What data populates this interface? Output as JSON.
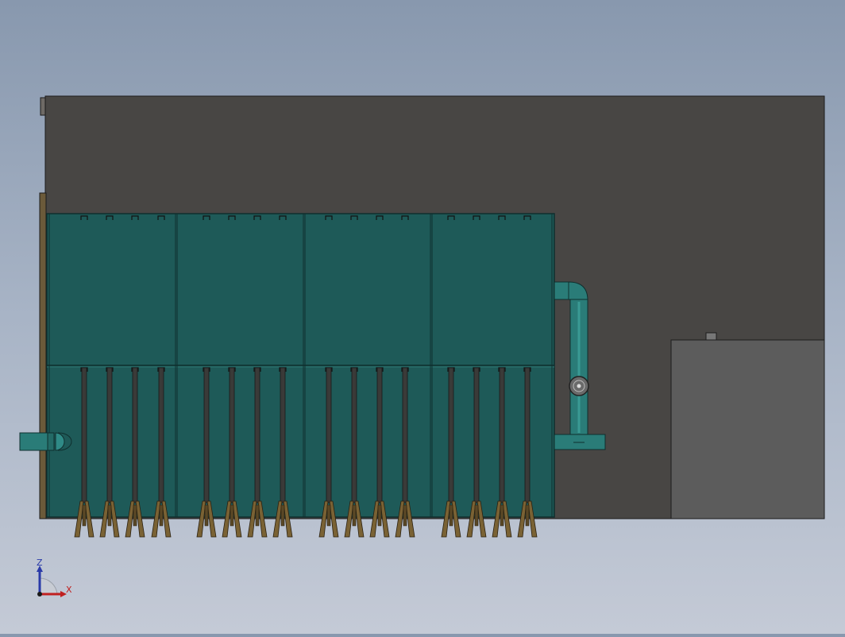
{
  "view": {
    "description_colors": {
      "background_top": "#8898ae",
      "background_bottom": "#c4cad6",
      "frame_body": "#484644",
      "tank_fill": "#1e5a58",
      "tank_edge": "#0f2f2e",
      "pipe": "#2a7c78",
      "rod": "#3a3a38",
      "mixer_blade": "#7a6234",
      "side_box": "#5c5c5c"
    },
    "module_count": 4,
    "rods_per_module": 4
  },
  "triad": {
    "z_label": "Z",
    "x_label": "X",
    "z_color": "#2a3aa8",
    "x_color": "#c02020"
  }
}
